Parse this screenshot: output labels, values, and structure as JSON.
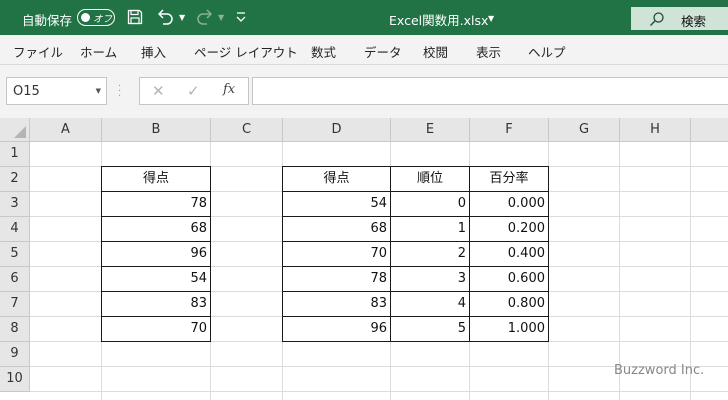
{
  "titlebar": {
    "autosave_label": "自動保存",
    "autosave_state": "オフ",
    "file_title": "Excel関数用.xlsx",
    "search_label": "検索",
    "accent_color": "#217346"
  },
  "ribbon": {
    "tabs": [
      "ファイル",
      "ホーム",
      "挿入",
      "ページ レイアウト",
      "数式",
      "データ",
      "校閲",
      "表示",
      "ヘルプ"
    ]
  },
  "formula_bar": {
    "name_box": "O15",
    "fx_label": "fx",
    "formula": ""
  },
  "grid": {
    "columns": [
      "A",
      "B",
      "C",
      "D",
      "E",
      "F",
      "G",
      "H"
    ],
    "rows": [
      "1",
      "2",
      "3",
      "4",
      "5",
      "6",
      "7",
      "8",
      "9",
      "10"
    ]
  },
  "table1": {
    "header": "得点",
    "values": [
      "78",
      "68",
      "96",
      "54",
      "83",
      "70"
    ]
  },
  "table2": {
    "headers": [
      "得点",
      "順位",
      "百分率"
    ],
    "rows": [
      [
        "54",
        "0",
        "0.000"
      ],
      [
        "68",
        "1",
        "0.200"
      ],
      [
        "70",
        "2",
        "0.400"
      ],
      [
        "78",
        "3",
        "0.600"
      ],
      [
        "83",
        "4",
        "0.800"
      ],
      [
        "96",
        "5",
        "1.000"
      ]
    ]
  },
  "watermark": "Buzzword Inc."
}
